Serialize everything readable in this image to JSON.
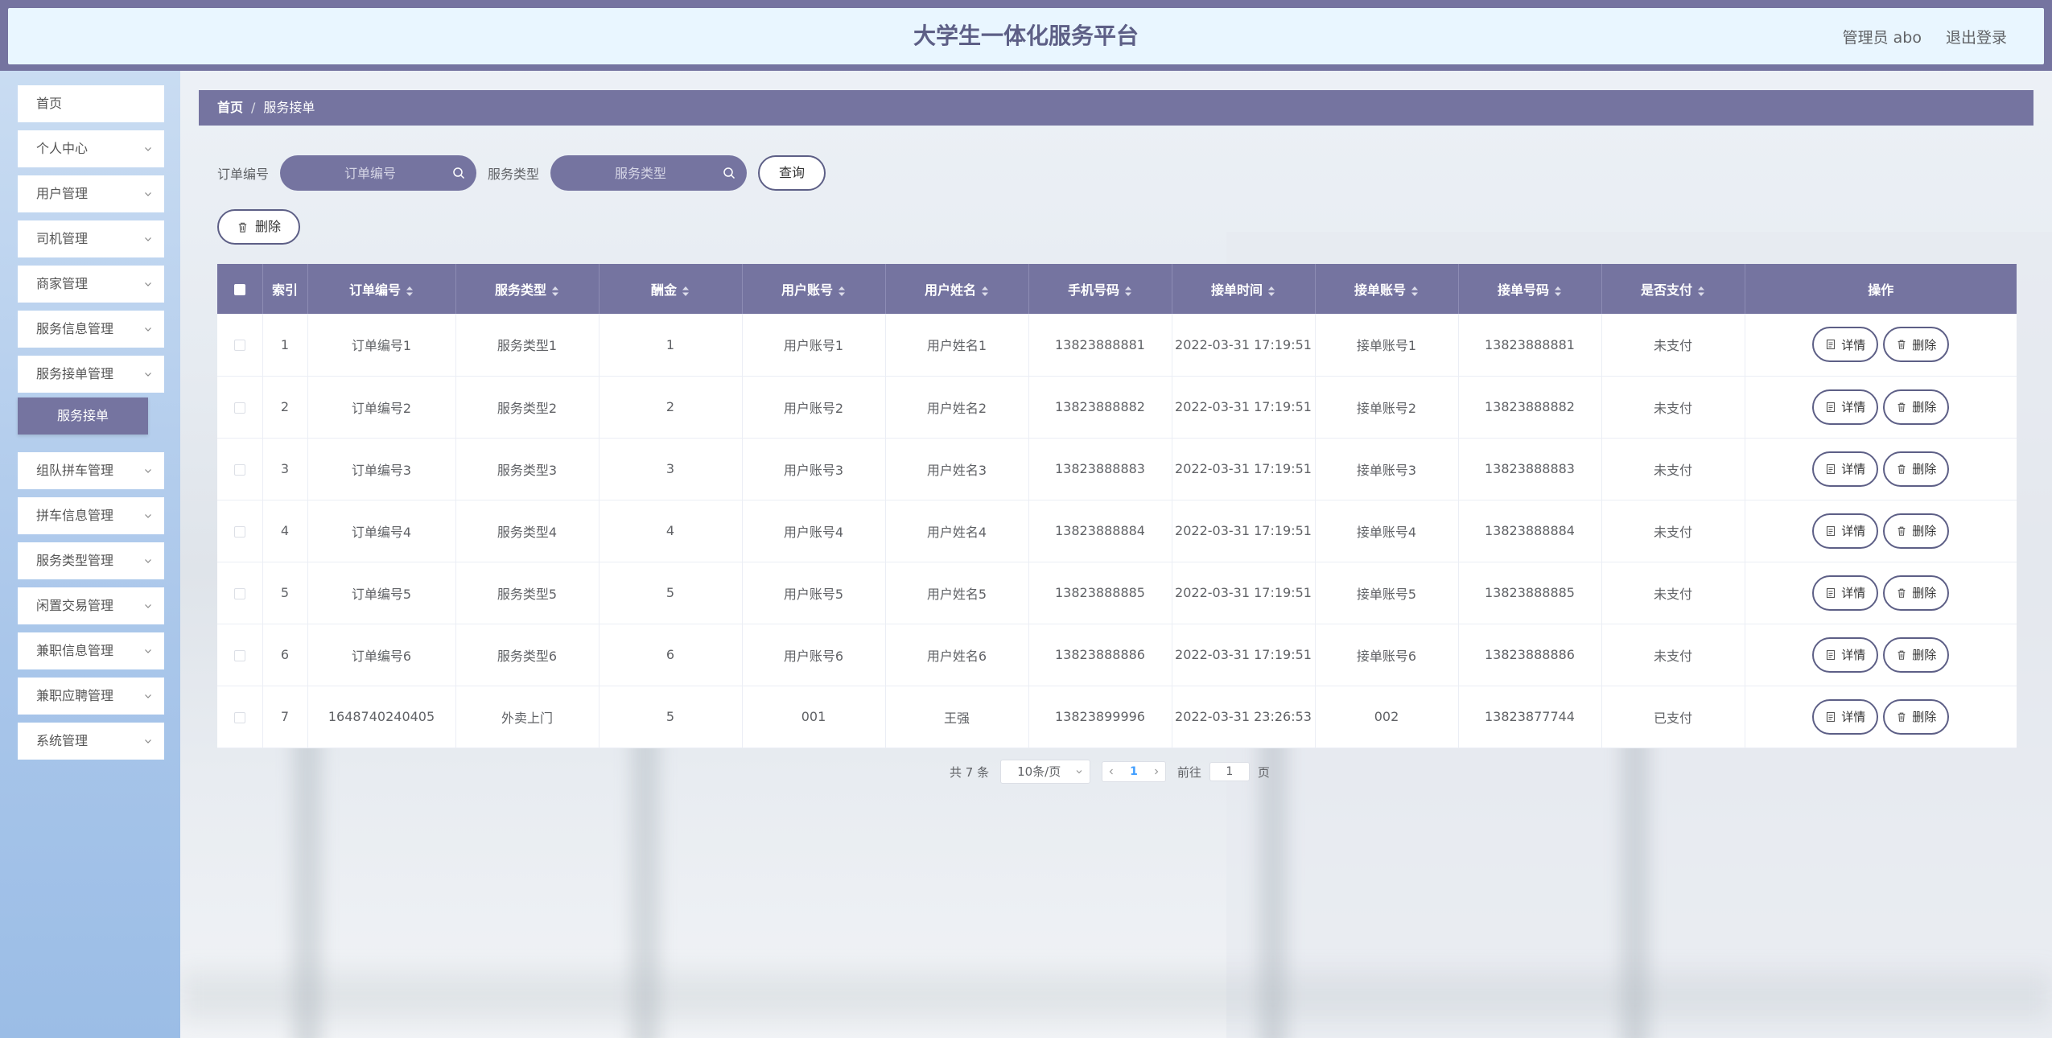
{
  "header": {
    "title": "大学生一体化服务平台",
    "user": "管理员 abo",
    "logout": "退出登录"
  },
  "sidebar": {
    "items": [
      {
        "label": "首页",
        "chevron": false
      },
      {
        "label": "个人中心",
        "chevron": true
      },
      {
        "label": "用户管理",
        "chevron": true
      },
      {
        "label": "司机管理",
        "chevron": true
      },
      {
        "label": "商家管理",
        "chevron": true
      },
      {
        "label": "服务信息管理",
        "chevron": true
      },
      {
        "label": "服务接单管理",
        "chevron": true
      },
      {
        "label": "组队拼车管理",
        "chevron": true
      },
      {
        "label": "拼车信息管理",
        "chevron": true
      },
      {
        "label": "服务类型管理",
        "chevron": true
      },
      {
        "label": "闲置交易管理",
        "chevron": true
      },
      {
        "label": "兼职信息管理",
        "chevron": true
      },
      {
        "label": "兼职应聘管理",
        "chevron": true
      },
      {
        "label": "系统管理",
        "chevron": true
      }
    ],
    "active_sub": "服务接单"
  },
  "breadcrumb": {
    "home": "首页",
    "separator": "/",
    "current": "服务接单"
  },
  "search": {
    "order_label": "订单编号",
    "order_placeholder": "订单编号",
    "type_label": "服务类型",
    "type_placeholder": "服务类型",
    "query_button": "查询",
    "delete_button": "删除"
  },
  "table": {
    "columns": [
      "索引",
      "订单编号",
      "服务类型",
      "酬金",
      "用户账号",
      "用户姓名",
      "手机号码",
      "接单时间",
      "接单账号",
      "接单号码",
      "是否支付",
      "操作"
    ],
    "rows": [
      [
        "1",
        "订单编号1",
        "服务类型1",
        "1",
        "用户账号1",
        "用户姓名1",
        "13823888881",
        "2022-03-31 17:19:51",
        "接单账号1",
        "13823888881",
        "未支付"
      ],
      [
        "2",
        "订单编号2",
        "服务类型2",
        "2",
        "用户账号2",
        "用户姓名2",
        "13823888882",
        "2022-03-31 17:19:51",
        "接单账号2",
        "13823888882",
        "未支付"
      ],
      [
        "3",
        "订单编号3",
        "服务类型3",
        "3",
        "用户账号3",
        "用户姓名3",
        "13823888883",
        "2022-03-31 17:19:51",
        "接单账号3",
        "13823888883",
        "未支付"
      ],
      [
        "4",
        "订单编号4",
        "服务类型4",
        "4",
        "用户账号4",
        "用户姓名4",
        "13823888884",
        "2022-03-31 17:19:51",
        "接单账号4",
        "13823888884",
        "未支付"
      ],
      [
        "5",
        "订单编号5",
        "服务类型5",
        "5",
        "用户账号5",
        "用户姓名5",
        "13823888885",
        "2022-03-31 17:19:51",
        "接单账号5",
        "13823888885",
        "未支付"
      ],
      [
        "6",
        "订单编号6",
        "服务类型6",
        "6",
        "用户账号6",
        "用户姓名6",
        "13823888886",
        "2022-03-31 17:19:51",
        "接单账号6",
        "13823888886",
        "未支付"
      ],
      [
        "7",
        "1648740240405",
        "外卖上门",
        "5",
        "001",
        "王强",
        "13823899996",
        "2022-03-31 23:26:53",
        "002",
        "13823877744",
        "已支付"
      ]
    ],
    "detail_label": "详情",
    "delete_label": "删除"
  },
  "pagination": {
    "total": "共 7 条",
    "page_size": "10条/页",
    "current_page": "1",
    "goto_label": "前往",
    "goto_value": "1",
    "page_suffix": "页"
  },
  "colors": {
    "accent": "#7574a0",
    "header_bg": "#e9f6ff",
    "title": "#5d5f86"
  },
  "icons": {
    "search": "search-icon",
    "delete": "trash-icon",
    "detail": "document-icon",
    "chevron": "chevron-down-icon"
  }
}
